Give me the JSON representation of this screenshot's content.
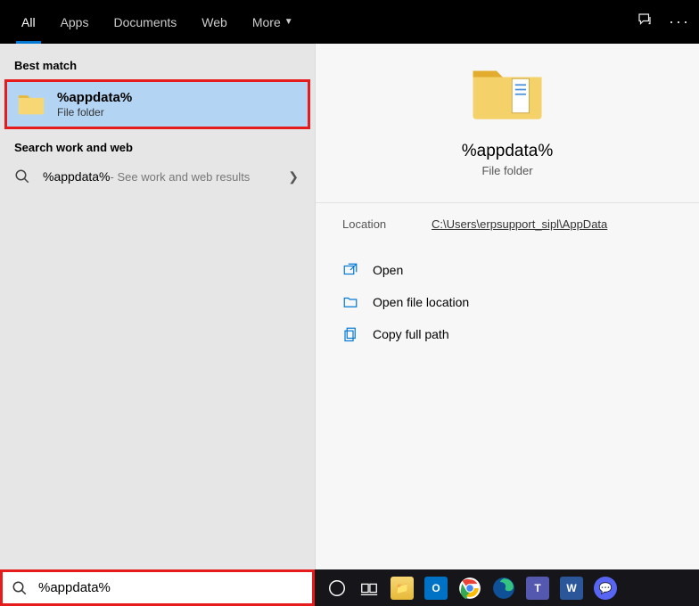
{
  "topbar": {
    "tabs": [
      "All",
      "Apps",
      "Documents",
      "Web",
      "More"
    ],
    "active_index": 0
  },
  "left": {
    "best_match_label": "Best match",
    "best_match": {
      "title": "%appdata%",
      "subtitle": "File folder"
    },
    "web_label": "Search work and web",
    "web_item": {
      "text": "%appdata%",
      "subtext": " - See work and web results"
    }
  },
  "right": {
    "title": "%appdata%",
    "subtitle": "File folder",
    "location_label": "Location",
    "location_value": "C:\\Users\\erpsupport_sipl\\AppData",
    "actions": {
      "open": "Open",
      "open_loc": "Open file location",
      "copy_path": "Copy full path"
    }
  },
  "search": {
    "value": "%appdata%"
  },
  "taskbar": {
    "apps": [
      "Explorer",
      "Outlook",
      "Chrome",
      "Edge",
      "Teams",
      "Word",
      "Discord"
    ]
  }
}
